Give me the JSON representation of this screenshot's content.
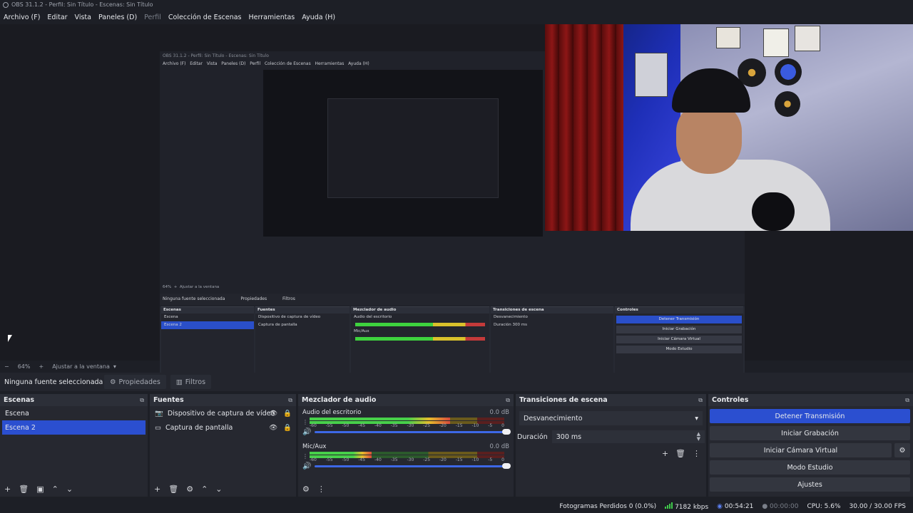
{
  "window": {
    "title": "OBS 31.1.2 - Perfil: Sin Título - Escenas: Sin Título"
  },
  "menu": [
    {
      "label": "Archivo (F)",
      "dim": false
    },
    {
      "label": "Editar",
      "dim": false
    },
    {
      "label": "Vista",
      "dim": false
    },
    {
      "label": "Paneles (D)",
      "dim": false
    },
    {
      "label": "Perfil",
      "dim": true
    },
    {
      "label": "Colección de Escenas",
      "dim": false
    },
    {
      "label": "Herramientas",
      "dim": false
    },
    {
      "label": "Ayuda (H)",
      "dim": false
    }
  ],
  "preview": {
    "zoom": "64%",
    "fit_label": "Ajustar a la ventana"
  },
  "props_bar": {
    "no_source": "Ninguna fuente seleccionada",
    "properties": "Propiedades",
    "filters": "Filtros"
  },
  "scenes": {
    "title": "Escenas",
    "items": [
      "Escena",
      "Escena 2"
    ],
    "selected_index": 1
  },
  "sources": {
    "title": "Fuentes",
    "items": [
      {
        "label": "Dispositivo de captura de vídeo",
        "icon": "camera-icon"
      },
      {
        "label": "Captura de pantalla",
        "icon": "monitor-icon"
      }
    ]
  },
  "mixer": {
    "title": "Mezclador de audio",
    "ticks": [
      "-60",
      "-55",
      "-50",
      "-45",
      "-40",
      "-35",
      "-30",
      "-25",
      "-20",
      "-15",
      "-10",
      "-5",
      "0"
    ],
    "channels": [
      {
        "name": "Audio del escritorio",
        "db": "0.0 dB",
        "level": 0.72,
        "volume": 1.0
      },
      {
        "name": "Mic/Aux",
        "db": "0.0 dB",
        "level": 0.32,
        "volume": 1.0
      }
    ]
  },
  "transitions": {
    "title": "Transiciones de escena",
    "selected": "Desvanecimiento",
    "duration_label": "Duración",
    "duration_value": "300 ms"
  },
  "controls": {
    "title": "Controles",
    "stop_stream": "Detener Transmisión",
    "start_recording": "Iniciar Grabación",
    "start_virtual_cam": "Iniciar Cámara Virtual",
    "studio_mode": "Modo Estudio",
    "settings": "Ajustes"
  },
  "status": {
    "dropped_frames": "Fotogramas Perdidos 0 (0.0%)",
    "bitrate": "7182 kbps",
    "stream_time": "00:54:21",
    "rec_time": "00:00:00",
    "cpu": "CPU: 5.6%",
    "fps": "30.00 / 30.00 FPS"
  },
  "colors": {
    "accent": "#2b4fd0",
    "meter_green": "#47d04a",
    "meter_yellow": "#e6bd2b",
    "meter_red": "#d84a3c"
  }
}
